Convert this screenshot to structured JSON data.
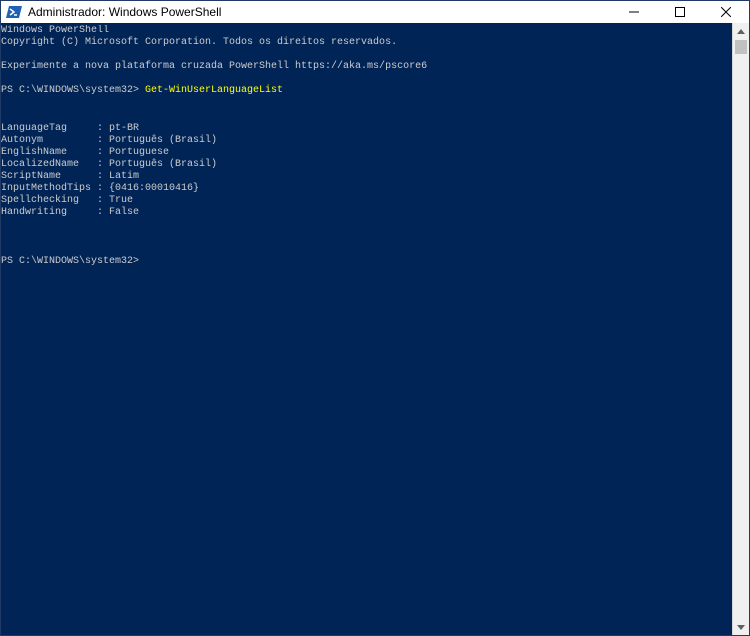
{
  "window": {
    "title": "Administrador: Windows PowerShell",
    "app_icon": "powershell-icon",
    "controls": [
      "minimize-icon",
      "maximize-icon",
      "close-icon"
    ]
  },
  "console": {
    "header_line1": "Windows PowerShell",
    "header_line2": "Copyright (C) Microsoft Corporation. Todos os direitos reservados.",
    "header_line3": "Experimente a nova plataforma cruzada PowerShell https://aka.ms/pscore6",
    "prompt": "PS C:\\WINDOWS\\system32> ",
    "command": "Get-WinUserLanguageList",
    "output": [
      {
        "key": "LanguageTag     ",
        "value": ": pt-BR"
      },
      {
        "key": "Autonym         ",
        "value": ": Português (Brasil)"
      },
      {
        "key": "EnglishName     ",
        "value": ": Portuguese"
      },
      {
        "key": "LocalizedName   ",
        "value": ": Português (Brasil)"
      },
      {
        "key": "ScriptName      ",
        "value": ": Latim"
      },
      {
        "key": "InputMethodTips ",
        "value": ": {0416:00010416}"
      },
      {
        "key": "Spellchecking   ",
        "value": ": True"
      },
      {
        "key": "Handwriting     ",
        "value": ": False"
      }
    ],
    "final_prompt": "PS C:\\WINDOWS\\system32>"
  },
  "colors": {
    "background": "#012456",
    "text": "#cccccc",
    "command": "#ffff00"
  }
}
